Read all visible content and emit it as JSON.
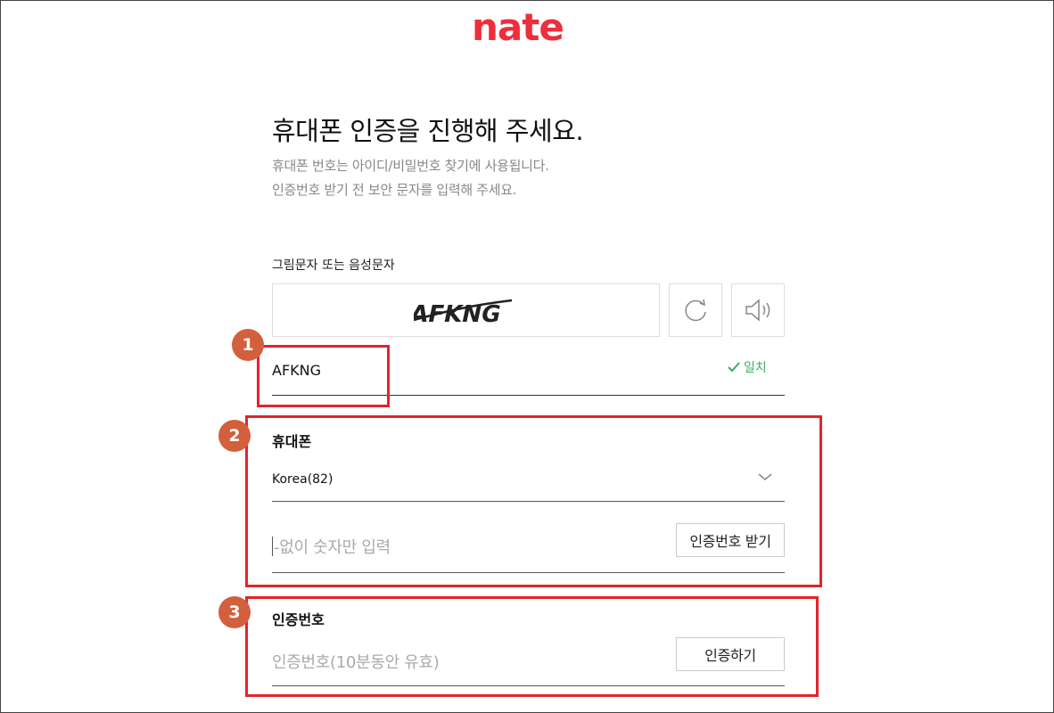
{
  "logo": "nate",
  "heading": {
    "title": "휴대폰 인증을 진행해 주세요.",
    "desc_line1": "휴대폰 번호는 아이디/비밀번호 찾기에 사용됩니다.",
    "desc_line2": "인증번호 받기 전 보안 문자를 입력해 주세요."
  },
  "captcha": {
    "label": "그림문자 또는 음성문자",
    "image_text": "AFKNG",
    "refresh_icon": "refresh-icon",
    "audio_icon": "speaker-icon",
    "input_value": "AFKNG",
    "match_text": "일치"
  },
  "phone": {
    "label": "휴대폰",
    "country_value": "Korea(82)",
    "number_placeholder": "-없이 숫자만 입력",
    "request_button": "인증번호 받기"
  },
  "verify": {
    "label": "인증번호",
    "code_placeholder": "인증번호(10분동안 유효)",
    "verify_button": "인증하기"
  },
  "annotations": {
    "badge1": "1",
    "badge2": "2",
    "badge3": "3",
    "box_color": "#e3242b",
    "badge_color": "#d35f3c"
  },
  "colors": {
    "brand": "#ee2e3a",
    "match_green": "#3cab6b"
  }
}
